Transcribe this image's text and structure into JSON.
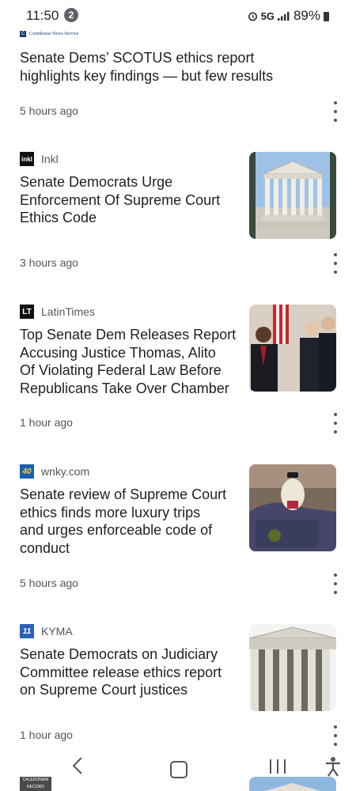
{
  "status": {
    "time": "11:50",
    "notification_count": "2",
    "network": "5G",
    "battery": "89%"
  },
  "articles": [
    {
      "source": "Courthouse News Service",
      "logo_text": "C",
      "headline_lines": [
        "Senate Dems’ SCOTUS ethics report",
        "highlights key findings — but few results"
      ],
      "time": "5 hours ago"
    },
    {
      "source": "Inkl",
      "logo_text": "inkl",
      "headline_lines": [
        "Senate Democrats Urge",
        "Enforcement Of Supreme Court",
        "Ethics Code"
      ],
      "time": "3 hours ago",
      "thumbnail": "supreme-court-building-photo"
    },
    {
      "source": "LatinTimes",
      "logo_text": "LT",
      "headline_lines": [
        "Top Senate Dem Releases Report",
        "Accusing Justice Thomas, Alito",
        "Of Violating Federal Law Before",
        "Republicans Take Over Chamber"
      ],
      "time": "1 hour ago",
      "thumbnail": "justices-photo"
    },
    {
      "source": "wnky.com",
      "logo_text": "40",
      "headline_lines": [
        "Senate review of Supreme Court",
        "ethics finds more luxury trips",
        "and urges enforceable code of",
        "conduct"
      ],
      "time": "5 hours ago",
      "thumbnail": "dog-in-wagon-photo"
    },
    {
      "source": "KYMA",
      "logo_text": "11",
      "headline_lines": [
        "Senate Democrats on Judiciary",
        "Committee release ethics report",
        "on Supreme Court justices"
      ],
      "time": "1 hour ago",
      "thumbnail": "court-columns-photo"
    }
  ],
  "next_source_logo_text": "CALEDONIAN RECORD",
  "nav": {
    "back": "back-icon",
    "home": "home-icon",
    "recents": "recents-icon",
    "accessibility": "accessibility-icon"
  }
}
